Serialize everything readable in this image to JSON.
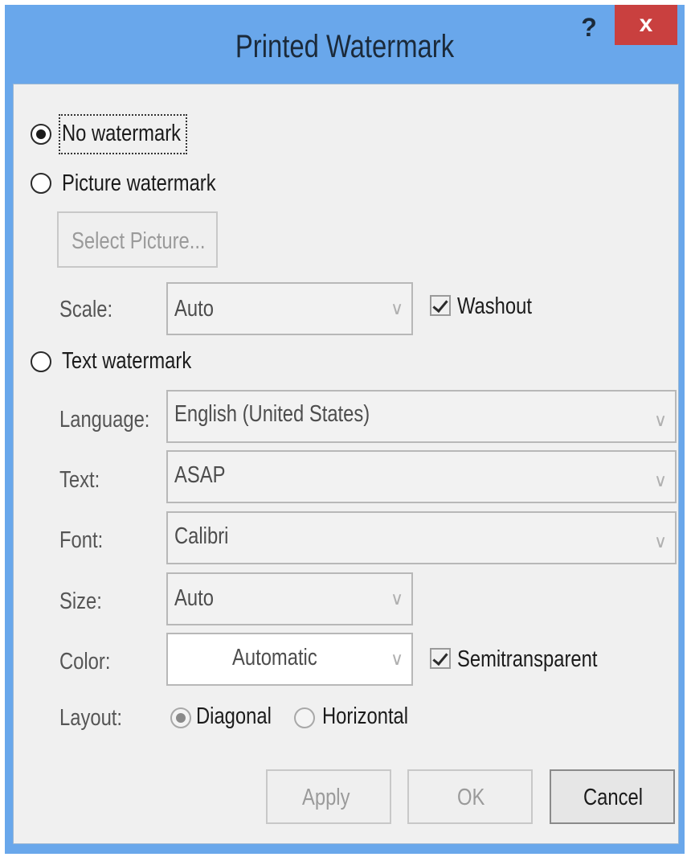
{
  "dialog": {
    "title": "Printed Watermark",
    "help_label": "?",
    "close_label": "x",
    "accent_color": "#69a7eb",
    "close_color": "#c9403f"
  },
  "options": {
    "no_watermark": {
      "label": "No watermark",
      "checked": true
    },
    "picture_watermark": {
      "label": "Picture watermark",
      "checked": false
    },
    "text_watermark": {
      "label": "Text watermark",
      "checked": false
    }
  },
  "picture": {
    "select_picture_label": "Select Picture...",
    "scale_label": "Scale:",
    "scale_value": "Auto",
    "washout_label": "Washout",
    "washout_checked": true
  },
  "text": {
    "language_label": "Language:",
    "language_value": "English (United States)",
    "text_label": "Text:",
    "text_value": "ASAP",
    "font_label": "Font:",
    "font_value": "Calibri",
    "size_label": "Size:",
    "size_value": "Auto",
    "color_label": "Color:",
    "color_value": "Automatic",
    "semitransparent_label": "Semitransparent",
    "semitransparent_checked": true,
    "layout_label": "Layout:",
    "layout_options": [
      {
        "label": "Diagonal",
        "checked": true
      },
      {
        "label": "Horizontal",
        "checked": false
      }
    ]
  },
  "buttons": {
    "apply": "Apply",
    "ok": "OK",
    "cancel": "Cancel"
  },
  "icons": {
    "dropdown": "chevron-down-icon",
    "close": "close-icon",
    "help": "help-icon"
  }
}
